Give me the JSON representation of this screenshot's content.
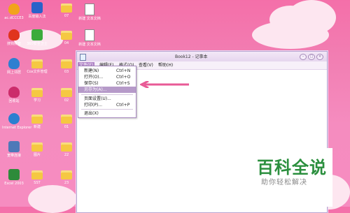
{
  "desktop": {
    "icons_col1": [
      {
        "label": "ac.dCCCE3",
        "icon": "heart-icon",
        "color": "#f2a31c"
      },
      {
        "label": "搜狗拼音",
        "icon": "heart-icon",
        "color": "#e0341d"
      },
      {
        "label": "网上邻居",
        "icon": "heart-icon",
        "color": "#2d7fd0"
      },
      {
        "label": "回收站",
        "icon": "heart-icon",
        "color": "#cc2c6b"
      },
      {
        "label": "Internet Explorer",
        "icon": "globe-icon",
        "color": "#2d7fd0"
      },
      {
        "label": "宽带连接",
        "icon": "network-icon",
        "color": "#4e79b8"
      },
      {
        "label": "Excel 2003",
        "icon": "excel-icon",
        "color": "#2e8b3a"
      }
    ],
    "icons_col2": [
      {
        "label": "百度输入法",
        "icon": "shield-icon",
        "color": "#2a62c9"
      },
      {
        "label": "360安全卫士",
        "icon": "shield-icon",
        "color": "#3cab3c"
      },
      {
        "label": "Cox文件管理",
        "icon": "folder-icon",
        "color": "#f5c842"
      },
      {
        "label": "学习",
        "icon": "folder-icon",
        "color": "#f5c842"
      },
      {
        "label": "新建",
        "icon": "folder-icon",
        "color": "#f5c842"
      },
      {
        "label": "图片",
        "icon": "folder-icon",
        "color": "#f5c842"
      },
      {
        "label": "SST",
        "icon": "folder-icon",
        "color": "#f5c842"
      }
    ],
    "icons_col3": [
      {
        "label": "07",
        "icon": "folder-icon"
      },
      {
        "label": "04",
        "icon": "folder-icon"
      },
      {
        "label": "03",
        "icon": "folder-icon"
      },
      {
        "label": "02",
        "icon": "folder-icon"
      },
      {
        "label": "01",
        "icon": "folder-icon"
      },
      {
        "label": "22",
        "icon": "folder-icon"
      },
      {
        "label": "23",
        "icon": "folder-icon"
      }
    ],
    "icons_col4": [
      {
        "label": "新建 文本文档",
        "icon": "text-document-icon"
      },
      {
        "label": "新建 文本文档",
        "icon": "text-document-icon"
      }
    ]
  },
  "notepad": {
    "title": "Book12 - 记事本",
    "menu": [
      "文件(F)",
      "编辑(E)",
      "格式(O)",
      "查看(V)",
      "帮助(H)"
    ],
    "active_menu_index": 0,
    "file_menu": [
      {
        "label": "新建(N)",
        "shortcut": "Ctrl+N"
      },
      {
        "label": "打开(O)...",
        "shortcut": "Ctrl+O"
      },
      {
        "label": "保存(S)",
        "shortcut": "Ctrl+S"
      },
      {
        "label": "另存为(A)...",
        "shortcut": "",
        "highlighted": true
      },
      {
        "label": "页面设置(U)...",
        "shortcut": ""
      },
      {
        "label": "打印(P)...",
        "shortcut": "Ctrl+P"
      },
      {
        "label": "退出(X)",
        "shortcut": ""
      }
    ]
  },
  "annotation": {
    "arrow_color": "#e85a96"
  },
  "watermark": {
    "title": "百科全说",
    "subtitle": "助你轻松解决",
    "color": "#2b8f3e"
  }
}
